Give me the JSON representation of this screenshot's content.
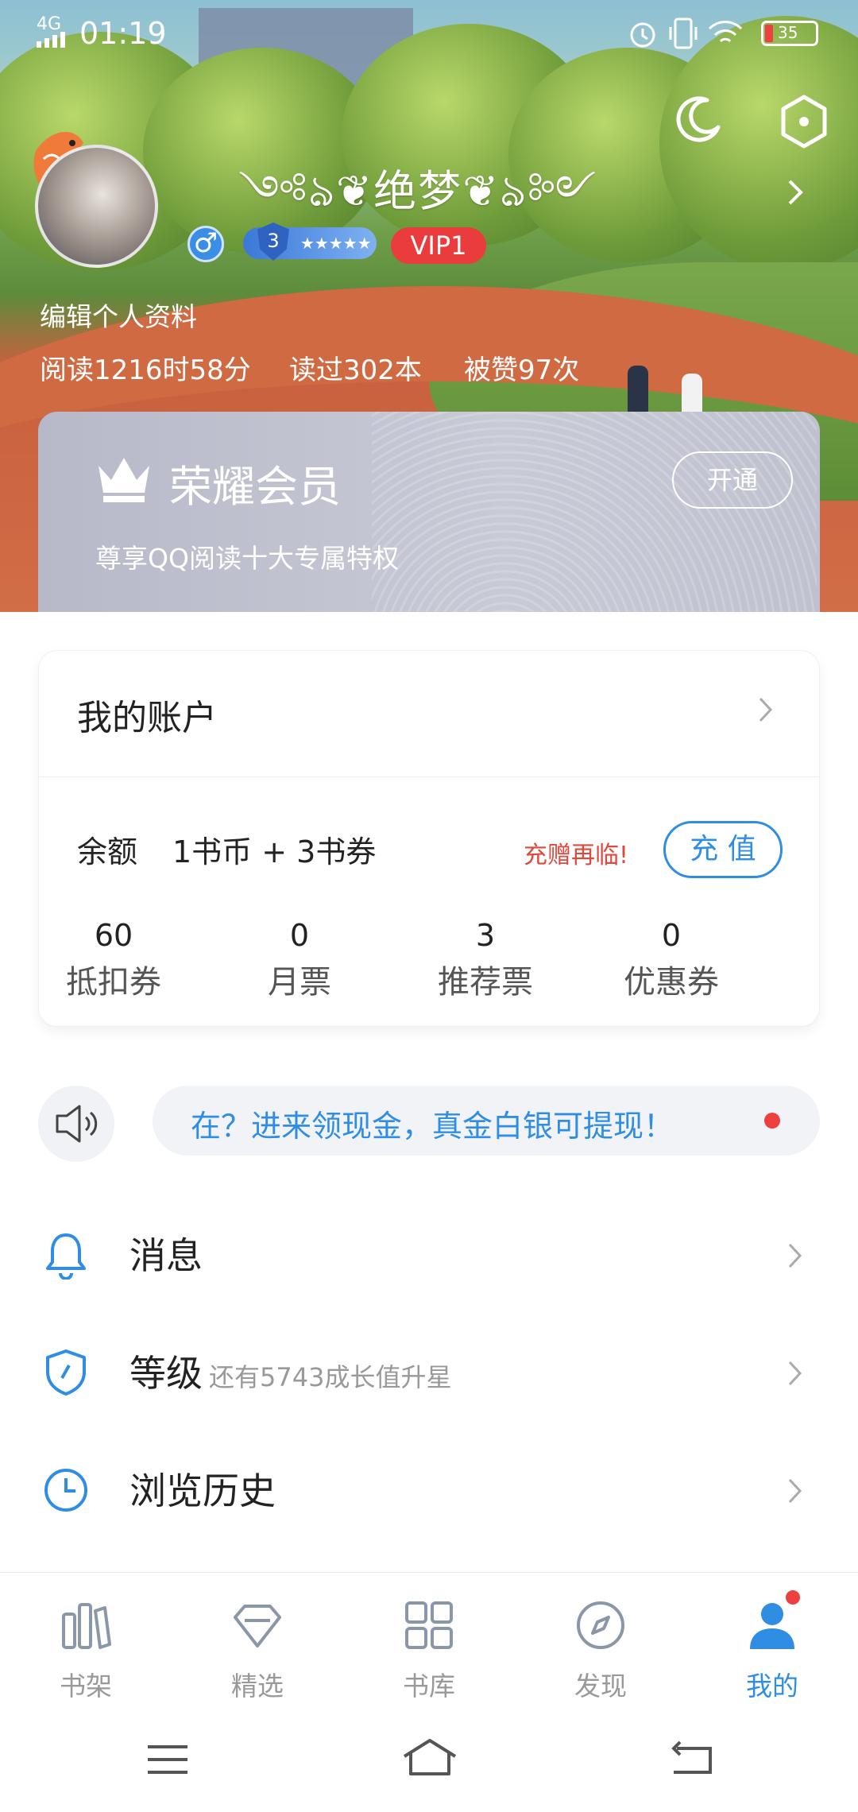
{
  "status_bar": {
    "network": "4G",
    "time": "01:19",
    "battery": "35"
  },
  "profile": {
    "username": "༺ঌ❦绝梦❦ঌ༻",
    "gender_symbol": "♂",
    "level": "3",
    "level_stars": "★★★★★",
    "vip": "VIP1",
    "edit_label": "编辑个人资料",
    "stats": {
      "reading_time": "阅读1216时58分",
      "books_read": "读过302本",
      "likes": "被赞97次"
    }
  },
  "member": {
    "title": "荣耀会员",
    "subtitle": "尊享QQ阅读十大专属特权",
    "button": "开通"
  },
  "account": {
    "title": "我的账户",
    "balance_label": "余额",
    "balance_value": "1书币 + 3书券",
    "promo": "充赠再临!",
    "recharge_button": "充 值",
    "tickets": [
      {
        "count": "60",
        "label": "抵扣券"
      },
      {
        "count": "0",
        "label": "月票"
      },
      {
        "count": "3",
        "label": "推荐票"
      },
      {
        "count": "0",
        "label": "优惠券"
      }
    ]
  },
  "notice": {
    "text": "在？进来领现金，真金白银可提现！"
  },
  "menu": [
    {
      "label": "消息",
      "sub": "",
      "icon": "bell-icon"
    },
    {
      "label": "等级",
      "sub": "还有5743成长值升星",
      "icon": "shield-check-icon"
    },
    {
      "label": "浏览历史",
      "sub": "",
      "icon": "clock-icon"
    }
  ],
  "tabs": [
    {
      "label": "书架",
      "icon": "bookshelf-icon"
    },
    {
      "label": "精选",
      "icon": "diamond-icon"
    },
    {
      "label": "书库",
      "icon": "grid-icon"
    },
    {
      "label": "发现",
      "icon": "compass-icon"
    },
    {
      "label": "我的",
      "icon": "person-icon",
      "active": true
    }
  ],
  "colors": {
    "accent": "#2f8de4",
    "vip_red": "#ea3c3c",
    "promo_red": "#e0483d",
    "badge_dot": "#ef4040"
  }
}
